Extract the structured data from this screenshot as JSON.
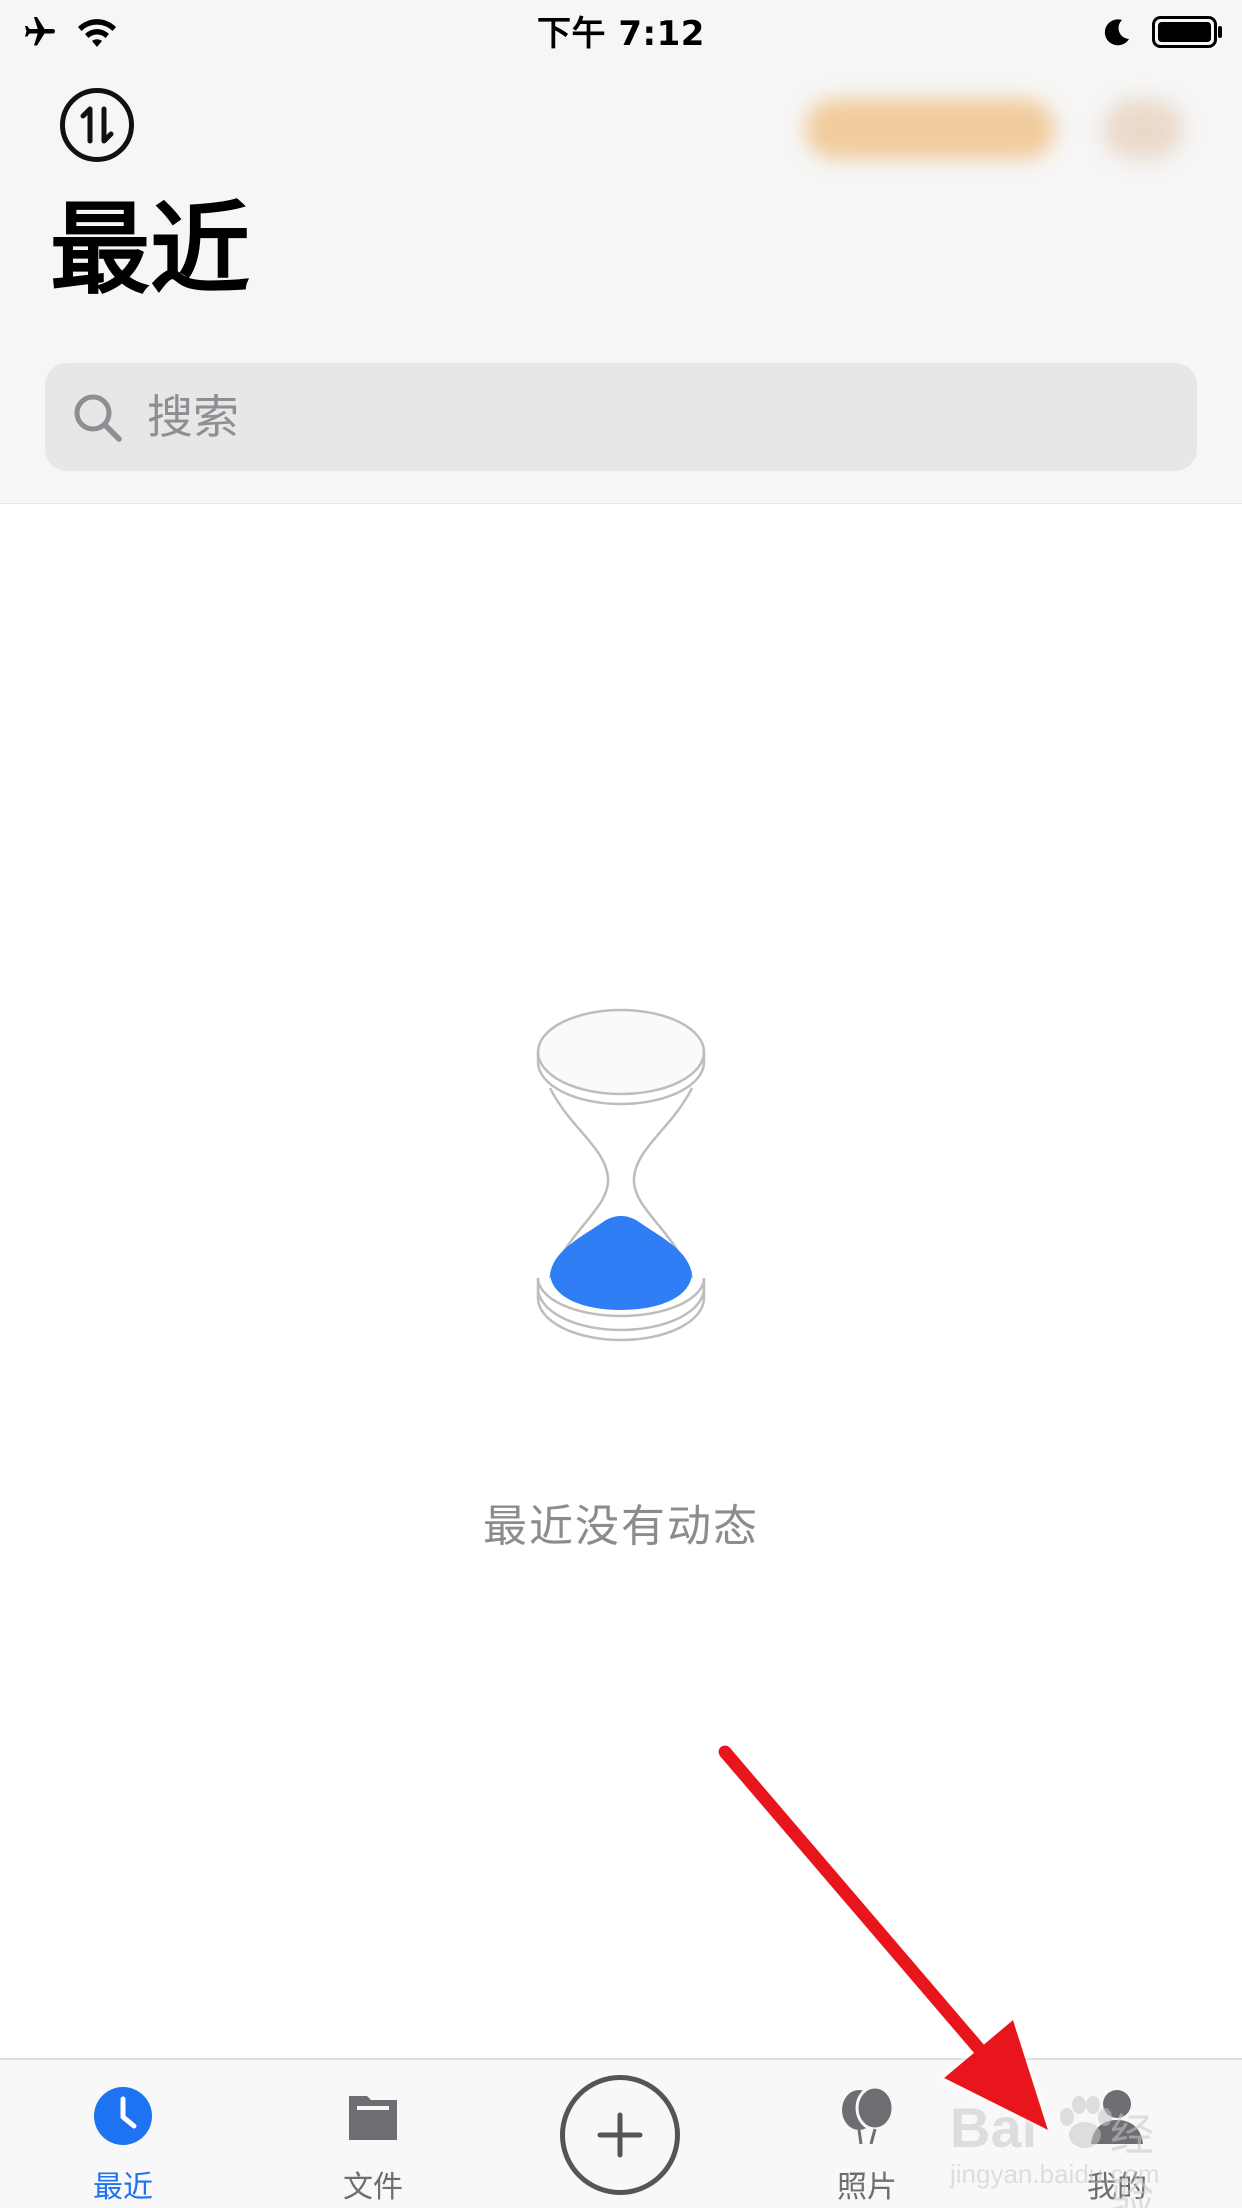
{
  "status_bar": {
    "time": "下午 7:12",
    "left_icons": [
      "airplane-icon",
      "wifi-icon"
    ],
    "right_icons": [
      "moon-icon",
      "battery-icon"
    ]
  },
  "header": {
    "title": "最近",
    "sort_icon": "transfer-arrows-icon"
  },
  "search": {
    "placeholder": "搜索",
    "value": ""
  },
  "empty_state": {
    "icon": "hourglass-icon",
    "message": "最近没有动态"
  },
  "tab_bar": {
    "active_color": "#1e73f2",
    "inactive_color": "#6d6d72",
    "tabs": [
      {
        "label": "最近",
        "icon": "clock-icon",
        "active": true
      },
      {
        "label": "文件",
        "icon": "folder-icon",
        "active": false
      },
      {
        "label": "照片",
        "icon": "balloons-icon",
        "active": false
      },
      {
        "label": "我的",
        "icon": "person-icon",
        "active": false
      }
    ],
    "add_icon": "plus-circle-icon"
  },
  "colors": {
    "accent": "#1e73f2",
    "header_background": "#f6f6f6",
    "annotation_arrow": "#e8141a"
  },
  "watermark": {
    "brand": "Bai",
    "brand_suffix": "经验",
    "url": "jingyan.baidu.com"
  }
}
